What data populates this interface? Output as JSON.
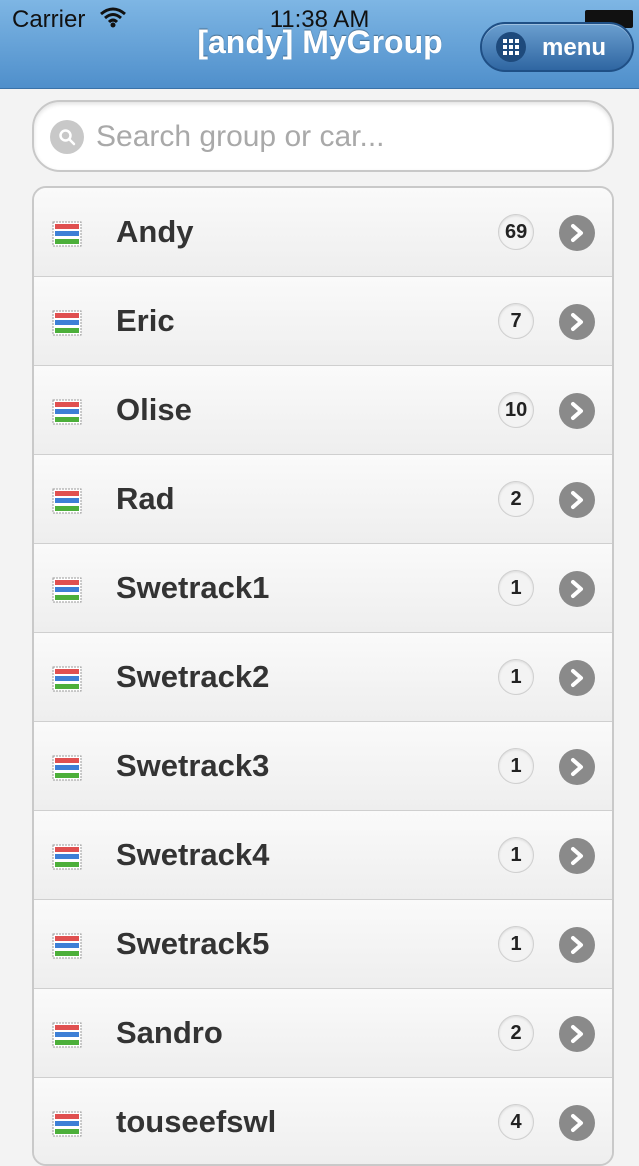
{
  "status": {
    "carrier": "Carrier",
    "time": "11:38 AM"
  },
  "header": {
    "title": "[andy] MyGroup",
    "menu_label": "menu"
  },
  "search": {
    "placeholder": "Search group or car..."
  },
  "groups": [
    {
      "name": "Andy",
      "count": "69"
    },
    {
      "name": "Eric",
      "count": "7"
    },
    {
      "name": "Olise",
      "count": "10"
    },
    {
      "name": "Rad",
      "count": "2"
    },
    {
      "name": "Swetrack1",
      "count": "1"
    },
    {
      "name": "Swetrack2",
      "count": "1"
    },
    {
      "name": "Swetrack3",
      "count": "1"
    },
    {
      "name": "Swetrack4",
      "count": "1"
    },
    {
      "name": "Swetrack5",
      "count": "1"
    },
    {
      "name": "Sandro",
      "count": "2"
    },
    {
      "name": "touseefswl",
      "count": "4"
    }
  ],
  "icons": {
    "group_icon": "group-list-icon",
    "chevron": "chevron-right-icon",
    "search": "search-icon",
    "menu": "grid-icon"
  },
  "colors": {
    "header_top": "#7eb6e4",
    "header_bottom": "#4f8fcb",
    "icon_red": "#e05050",
    "icon_blue": "#3d7fd6",
    "icon_green": "#4caf3a"
  }
}
